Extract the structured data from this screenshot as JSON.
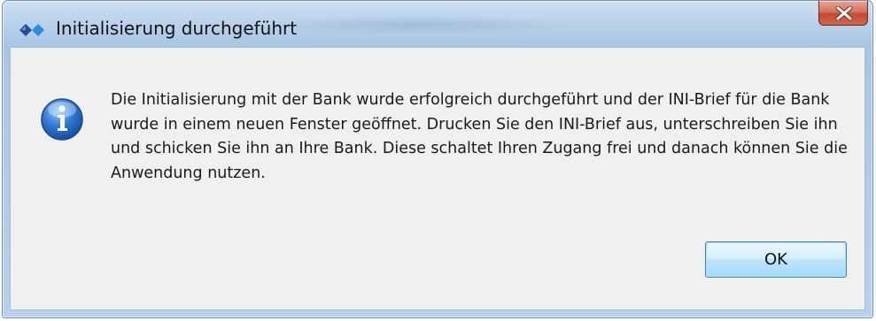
{
  "window": {
    "title": "Initialisierung durchgeführt",
    "app_icon": "diamond-app-icon",
    "close_icon": "close-icon",
    "accent_color": "#c24a31"
  },
  "dialog": {
    "icon": "info-icon",
    "message": "Die Initialisierung mit der Bank wurde erfolgreich durchgeführt und der INI-Brief für die Bank wurde in einem neuen Fenster geöffnet. Drucken Sie den INI-Brief aus, unterschreiben Sie ihn und schicken Sie ihn an Ihre Bank. Diese schaltet Ihren Zugang frei und danach können Sie die Anwendung nutzen.",
    "ok_label": "OK"
  }
}
